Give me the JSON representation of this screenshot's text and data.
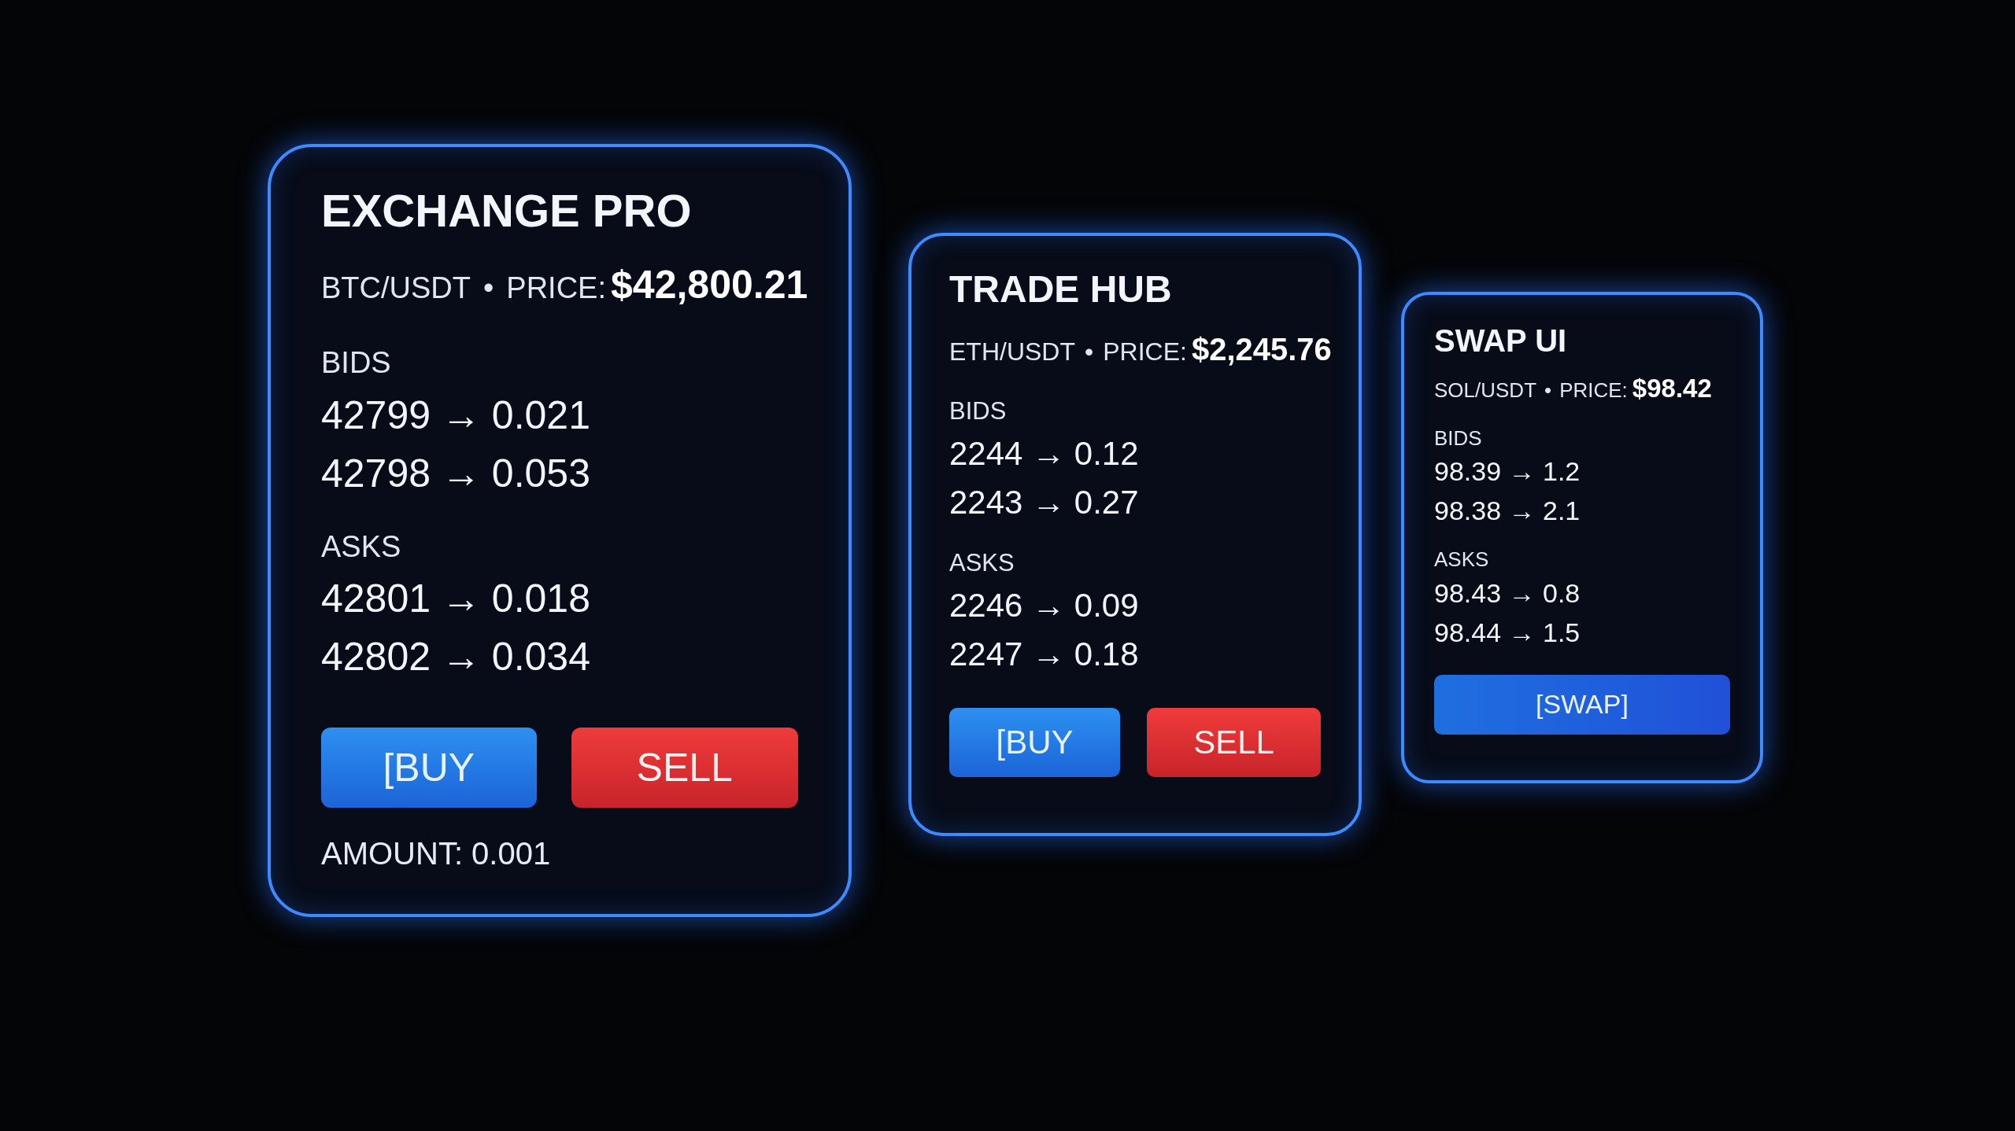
{
  "cards": [
    {
      "title": "EXCHANGE PRO",
      "pair": "BTC/USDT",
      "separator": "•",
      "price_label": "PRICE:",
      "price": "$42,800.21",
      "sections": [
        {
          "label": "BIDS",
          "rows": [
            "42799 → 0.021",
            "42798 → 0.053"
          ]
        },
        {
          "label": "ASKS",
          "rows": [
            "42801 → 0.018",
            "42802 → 0.034"
          ]
        }
      ],
      "buttons": [
        {
          "label": "[BUY",
          "kind": "buy"
        },
        {
          "label": "SELL",
          "kind": "sell"
        }
      ],
      "amount": "AMOUNT: 0.001"
    },
    {
      "title": "TRADE HUB",
      "pair": "ETH/USDT",
      "separator": "•",
      "price_label": "PRICE:",
      "price": "$2,245.76",
      "sections": [
        {
          "label": "BIDS",
          "rows": [
            "2244 → 0.12",
            "2243 → 0.27"
          ]
        },
        {
          "label": "ASKS",
          "rows": [
            "2246 → 0.09",
            "2247 → 0.18"
          ]
        }
      ],
      "buttons": [
        {
          "label": "[BUY",
          "kind": "buy"
        },
        {
          "label": "SELL",
          "kind": "sell"
        }
      ]
    },
    {
      "title": "SWAP UI",
      "pair": "SOL/USDT",
      "separator": "•",
      "price_label": "PRICE:",
      "price": "$98.42",
      "sections": [
        {
          "label": "BIDS",
          "rows": [
            "98.39 → 1.2",
            "98.38 → 2.1"
          ]
        },
        {
          "label": "ASKS",
          "rows": [
            "98.43 → 0.8",
            "98.44 → 1.5"
          ]
        }
      ],
      "buttons": [
        {
          "label": "[SWAP]",
          "kind": "swap"
        }
      ]
    }
  ]
}
